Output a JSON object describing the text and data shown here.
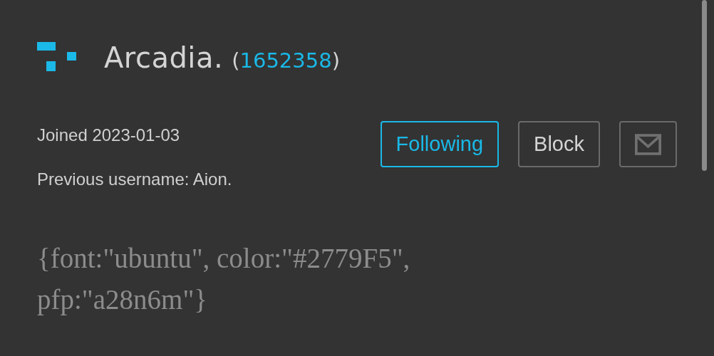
{
  "profile": {
    "username": "Arcadia.",
    "id_open": "(",
    "user_id": "1652358",
    "id_close": ")",
    "joined": "Joined 2023-01-03",
    "previous_username": "Previous username: Aion."
  },
  "buttons": [
    {
      "kind": "toggle",
      "label": "Following",
      "on": true
    },
    {
      "kind": "text",
      "label": "Block"
    },
    {
      "kind": "mail"
    }
  ],
  "bio": "{font:\"ubuntu\", color:\"#2779F5\", pfp:\"a28n6m\"}"
}
